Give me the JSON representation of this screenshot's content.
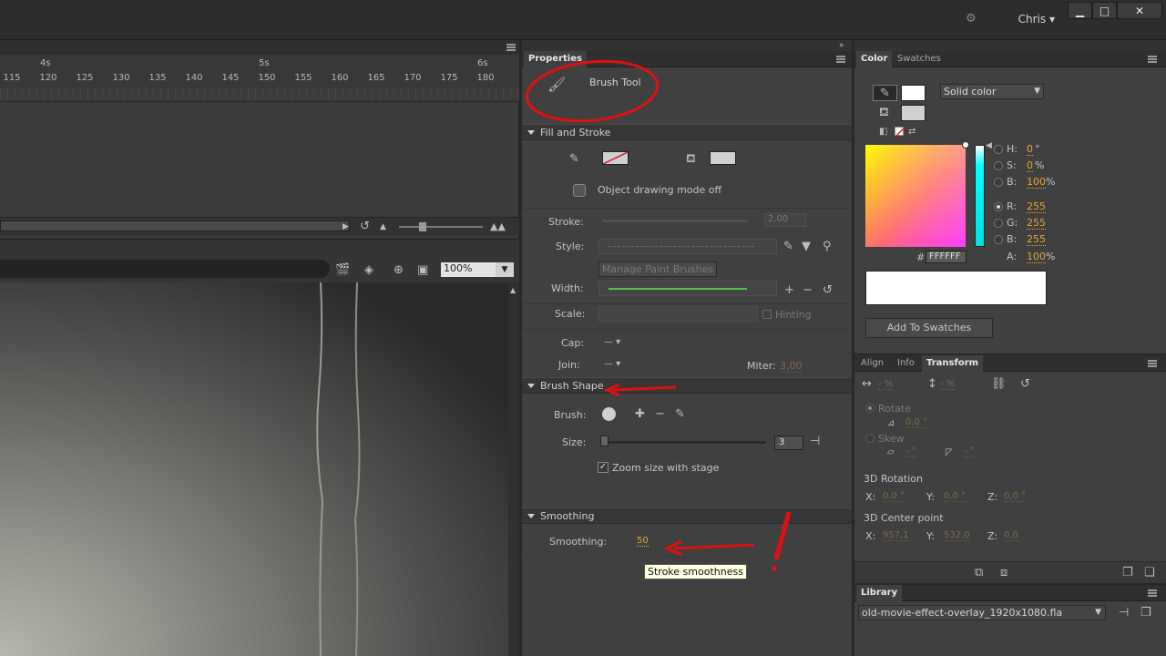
{
  "topbar": {
    "user": "Chris",
    "minimize": "▁",
    "maximize": "□",
    "close": "✕"
  },
  "timeline": {
    "seconds": [
      {
        "label": "4s"
      },
      {
        "label": "5s"
      },
      {
        "label": "6s"
      }
    ],
    "frames": [
      "115",
      "120",
      "125",
      "130",
      "135",
      "140",
      "145",
      "150",
      "155",
      "160",
      "165",
      "170",
      "175",
      "180"
    ]
  },
  "stage": {
    "zoom": "100%"
  },
  "properties": {
    "tab": "Properties",
    "tool_name": "Brush Tool",
    "fill_stroke": {
      "title": "Fill and Stroke",
      "object_drawing": "Object drawing mode off",
      "stroke_label": "Stroke:",
      "stroke_value": "2,00",
      "style_label": "Style:",
      "manage_brushes": "Manage Paint Brushes",
      "width_label": "Width:",
      "scale_label": "Scale:",
      "hinting": "Hinting",
      "cap_label": "Cap:",
      "join_label": "Join:",
      "miter_label": "Miter:",
      "miter_value": "3,00"
    },
    "brush_shape": {
      "title": "Brush Shape",
      "brush_label": "Brush:",
      "size_label": "Size:",
      "size_value": "3",
      "zoom_size": "Zoom size with stage"
    },
    "smoothing": {
      "title": "Smoothing",
      "label": "Smoothing:",
      "value": "50",
      "tooltip": "Stroke smoothness"
    }
  },
  "color_panel": {
    "tabs": [
      "Color",
      "Swatches"
    ],
    "fill_type": "Solid color",
    "hsb": [
      {
        "label": "H:",
        "value": "0",
        "unit": "°"
      },
      {
        "label": "S:",
        "value": "0",
        "unit": "%"
      },
      {
        "label": "B:",
        "value": "100",
        "unit": "%"
      }
    ],
    "rgb": [
      {
        "label": "R:",
        "value": "255"
      },
      {
        "label": "G:",
        "value": "255"
      },
      {
        "label": "B:",
        "value": "255"
      }
    ],
    "hex_label": "#",
    "hex_value": "FFFFFF",
    "alpha_label": "A:",
    "alpha_value": "100",
    "alpha_unit": "%",
    "add_swatch": "Add To Swatches",
    "colors": {
      "fill": "#ffffff",
      "stroke": "#d0d0d0"
    }
  },
  "transform_panel": {
    "tabs": [
      "Align",
      "Info",
      "Transform"
    ],
    "width_value": "- %",
    "height_value": "- %",
    "rotate_label": "Rotate",
    "rotate_value": "0,0 °",
    "skew_label": "Skew",
    "skew_h": "- °",
    "skew_v": "- °",
    "rot3d_title": "3D Rotation",
    "rot3d": [
      {
        "label": "X:",
        "value": "0,0 °"
      },
      {
        "label": "Y:",
        "value": "0,0 °"
      },
      {
        "label": "Z:",
        "value": "0,0 °"
      }
    ],
    "center_title": "3D Center point",
    "center": [
      {
        "label": "X:",
        "value": "957,1"
      },
      {
        "label": "Y:",
        "value": "532,0"
      },
      {
        "label": "Z:",
        "value": "0,0"
      }
    ]
  },
  "library": {
    "tab": "Library",
    "file": "old-movie-effect-overlay_1920x1080.fla"
  }
}
